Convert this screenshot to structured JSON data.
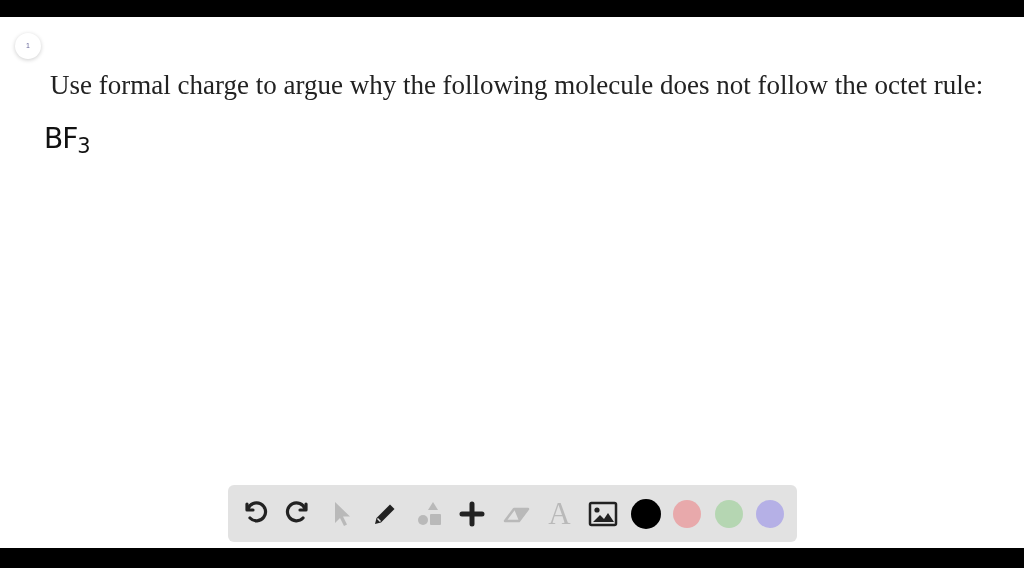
{
  "page_badge": "1",
  "question": "Use formal charge to argue why the following molecule does not follow the octet rule:",
  "handwriting": "BF$_{3}$",
  "toolbar": {
    "tools": [
      {
        "kind": "undo",
        "disabled": false
      },
      {
        "kind": "redo",
        "disabled": false
      },
      {
        "kind": "select",
        "disabled": true
      },
      {
        "kind": "pencil",
        "disabled": false
      },
      {
        "kind": "shapes",
        "disabled": true
      },
      {
        "kind": "plus",
        "disabled": false
      },
      {
        "kind": "eraser",
        "disabled": true
      },
      {
        "kind": "text",
        "glyph": "A",
        "disabled": true
      },
      {
        "kind": "image",
        "disabled": false
      }
    ],
    "colors": [
      {
        "color": "#000000",
        "selected": true
      },
      {
        "color": "#e8a9ab",
        "selected": false
      },
      {
        "color": "#b5d6b2",
        "selected": false
      },
      {
        "color": "#b5b0e6",
        "selected": false
      }
    ]
  }
}
